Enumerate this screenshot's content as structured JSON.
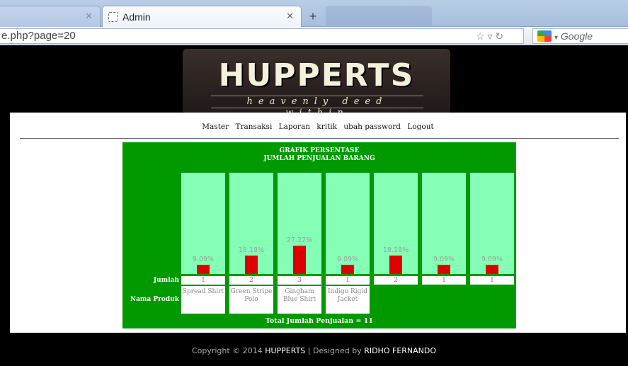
{
  "browser": {
    "tabs": [
      {
        "title": "",
        "active": false
      },
      {
        "title": "Admin",
        "active": true
      }
    ],
    "url": "e.php?page=20",
    "search_engine": "Google"
  },
  "site": {
    "logo_title": "HUPPERTS",
    "logo_tagline": "heavenly deed within"
  },
  "menu": [
    "Master",
    "Transaksi",
    "Laporan",
    "kritik",
    "ubah password",
    "Logout"
  ],
  "chart_data": {
    "type": "bar",
    "title_line1": "GRAFIK PERSENTASE",
    "title_line2": "JUMLAH PENJUALAN BARANG",
    "row_label_count": "Jumlah",
    "row_label_product": "Nama Produk",
    "categories": [
      "Spread Shirt",
      "Green Stripe Polo",
      "Gingham Blue Shirt",
      "Indigo Rigid Jacket",
      "",
      "",
      ""
    ],
    "percent_labels": [
      "9.09%",
      "18.18%",
      "27.27%",
      "9.09%",
      "18.18%",
      "9.09%",
      "9.09%"
    ],
    "values": [
      9.09,
      18.18,
      27.27,
      9.09,
      18.18,
      9.09,
      9.09
    ],
    "counts": [
      "1",
      "2",
      "3",
      "1",
      "2",
      "1",
      "1"
    ],
    "ylim": [
      0,
      100
    ],
    "total_label": "Total Jumlah Penjualan = 11",
    "colors": {
      "background": "#009900",
      "column": "#86ffb6",
      "bar": "#dd0000"
    }
  },
  "footer": {
    "prefix": "Copyright © 2014 ",
    "brand": "HUPPERTS",
    "middle": " | Designed by ",
    "designer": "RIDHO FERNANDO"
  }
}
